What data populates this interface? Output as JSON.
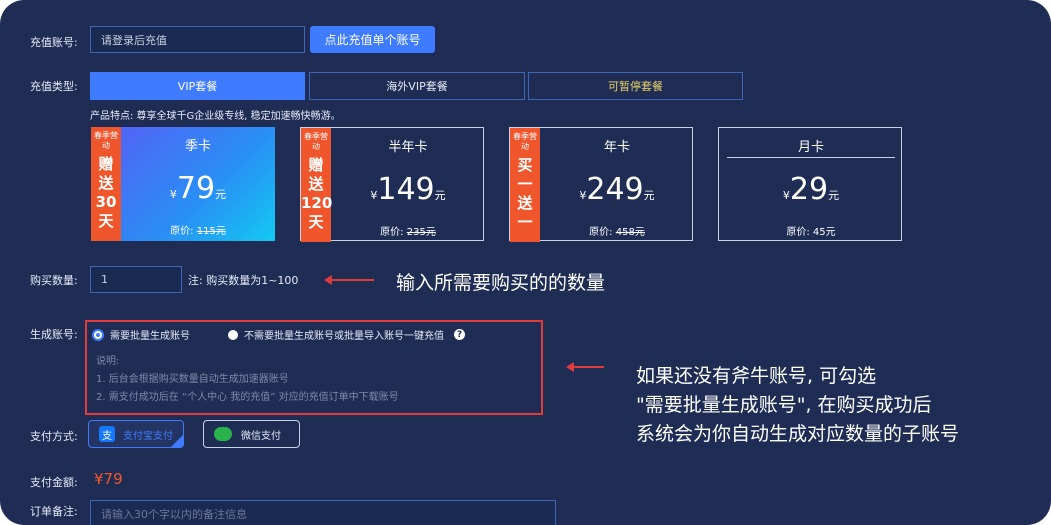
{
  "account": {
    "label": "充值账号:",
    "placeholder": "请登录后充值",
    "button": "点此充值单个账号"
  },
  "type": {
    "label": "充值类型:",
    "tabs": [
      {
        "label": "VIP套餐",
        "active": true
      },
      {
        "label": "海外VIP套餐",
        "active": false
      },
      {
        "label": "可暂停套餐",
        "active": false
      }
    ],
    "feature": "产品特点: 尊享全球千G企业级专线, 稳定加速畅快畅游。"
  },
  "plans": [
    {
      "name": "季卡",
      "currency": "¥",
      "price": "79",
      "unit": "元",
      "orig_label": "原价:",
      "orig_price": "115元",
      "promo_tag": "春季营动",
      "promo_text": [
        "赠",
        "送",
        "30",
        "天"
      ]
    },
    {
      "name": "半年卡",
      "currency": "¥",
      "price": "149",
      "unit": "元",
      "orig_label": "原价:",
      "orig_price": "235元",
      "promo_tag": "春季营动",
      "promo_text": [
        "赠",
        "送",
        "120",
        "天"
      ]
    },
    {
      "name": "年卡",
      "currency": "¥",
      "price": "249",
      "unit": "元",
      "orig_label": "原价:",
      "orig_price": "458元",
      "promo_tag": "春季营动",
      "promo_text": [
        "买",
        "一",
        "送",
        "一"
      ]
    },
    {
      "name": "月卡",
      "currency": "¥",
      "price": "29",
      "unit": "元",
      "orig_label": "原价:",
      "orig_price": "45元"
    }
  ],
  "quantity": {
    "label": "购买数量:",
    "value": "1",
    "note": "注: 购买数量为1~100",
    "annotation": "输入所需要购买的的数量"
  },
  "generate": {
    "label": "生成账号:",
    "option1": "需要批量生成账号",
    "option2": "不需要批量生成账号或批量导入账号一键充值",
    "help_icon": "?",
    "note_title": "说明:",
    "note1": "1. 后台会根据购买数量自动生成加速器账号",
    "note2": "2. 需支付成功后在 “个人中心 我的充值” 对应的充值订单中下载账号",
    "annotation": [
      "如果还没有斧牛账号, 可勾选",
      "\"需要批量生成账号\", 在购买成功后",
      "系统会为你自动生成对应数量的子账号"
    ]
  },
  "payment": {
    "label": "支付方式:",
    "alipay": "支付宝支付",
    "alipay_glyph": "支",
    "wechat": "微信支付"
  },
  "amount": {
    "label": "支付金额:",
    "value": "¥79"
  },
  "remark": {
    "label": "订单备注:",
    "placeholder": "请输入30个字以内的备注信息"
  },
  "colors": {
    "panel_bg": "#1f2d55",
    "accent": "#3e7bff",
    "promo": "#f0562c",
    "annotation_red": "#e13c3c",
    "price_orange": "#f0562c"
  }
}
